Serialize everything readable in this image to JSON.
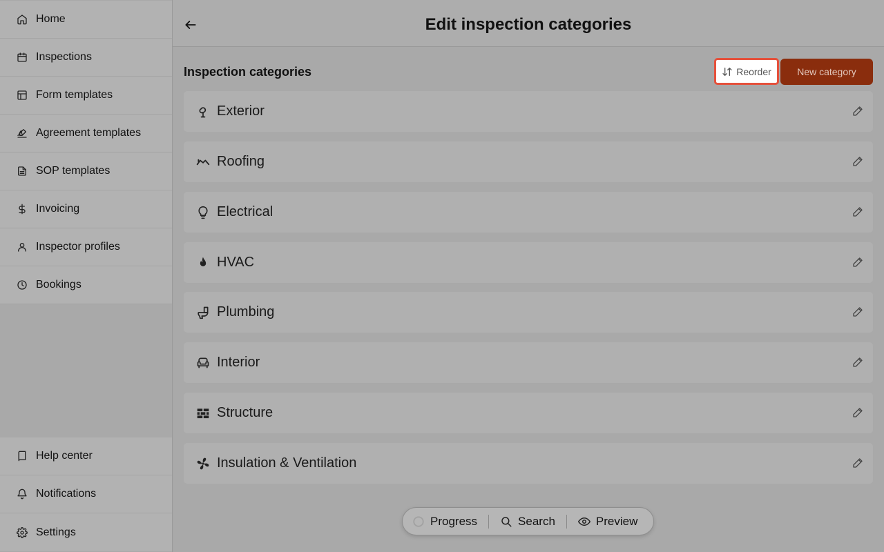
{
  "sidebar": {
    "top_items": [
      {
        "label": "Home",
        "icon": "home-icon"
      },
      {
        "label": "Inspections",
        "icon": "calendar-icon"
      },
      {
        "label": "Form templates",
        "icon": "layout-icon"
      },
      {
        "label": "Agreement templates",
        "icon": "signature-icon"
      },
      {
        "label": "SOP templates",
        "icon": "document-icon"
      },
      {
        "label": "Invoicing",
        "icon": "dollar-icon"
      },
      {
        "label": "Inspector profiles",
        "icon": "user-icon"
      },
      {
        "label": "Bookings",
        "icon": "clock-icon"
      }
    ],
    "bottom_items": [
      {
        "label": "Help center",
        "icon": "book-icon"
      },
      {
        "label": "Notifications",
        "icon": "bell-icon"
      },
      {
        "label": "Settings",
        "icon": "gear-icon"
      }
    ]
  },
  "header": {
    "title": "Edit inspection categories"
  },
  "main": {
    "section_title": "Inspection categories",
    "reorder_label": "Reorder",
    "new_category_label": "New category",
    "categories": [
      {
        "label": "Exterior",
        "icon": "tree-icon"
      },
      {
        "label": "Roofing",
        "icon": "roof-icon"
      },
      {
        "label": "Electrical",
        "icon": "lightbulb-icon"
      },
      {
        "label": "HVAC",
        "icon": "flame-icon"
      },
      {
        "label": "Plumbing",
        "icon": "toilet-icon"
      },
      {
        "label": "Interior",
        "icon": "sofa-icon"
      },
      {
        "label": "Structure",
        "icon": "brick-wall-icon"
      },
      {
        "label": "Insulation & Ventilation",
        "icon": "fan-icon"
      }
    ]
  },
  "toolbar": {
    "progress_label": "Progress",
    "search_label": "Search",
    "preview_label": "Preview"
  },
  "colors": {
    "accent": "#8a2d0d",
    "highlight_border": "#e5513c"
  }
}
